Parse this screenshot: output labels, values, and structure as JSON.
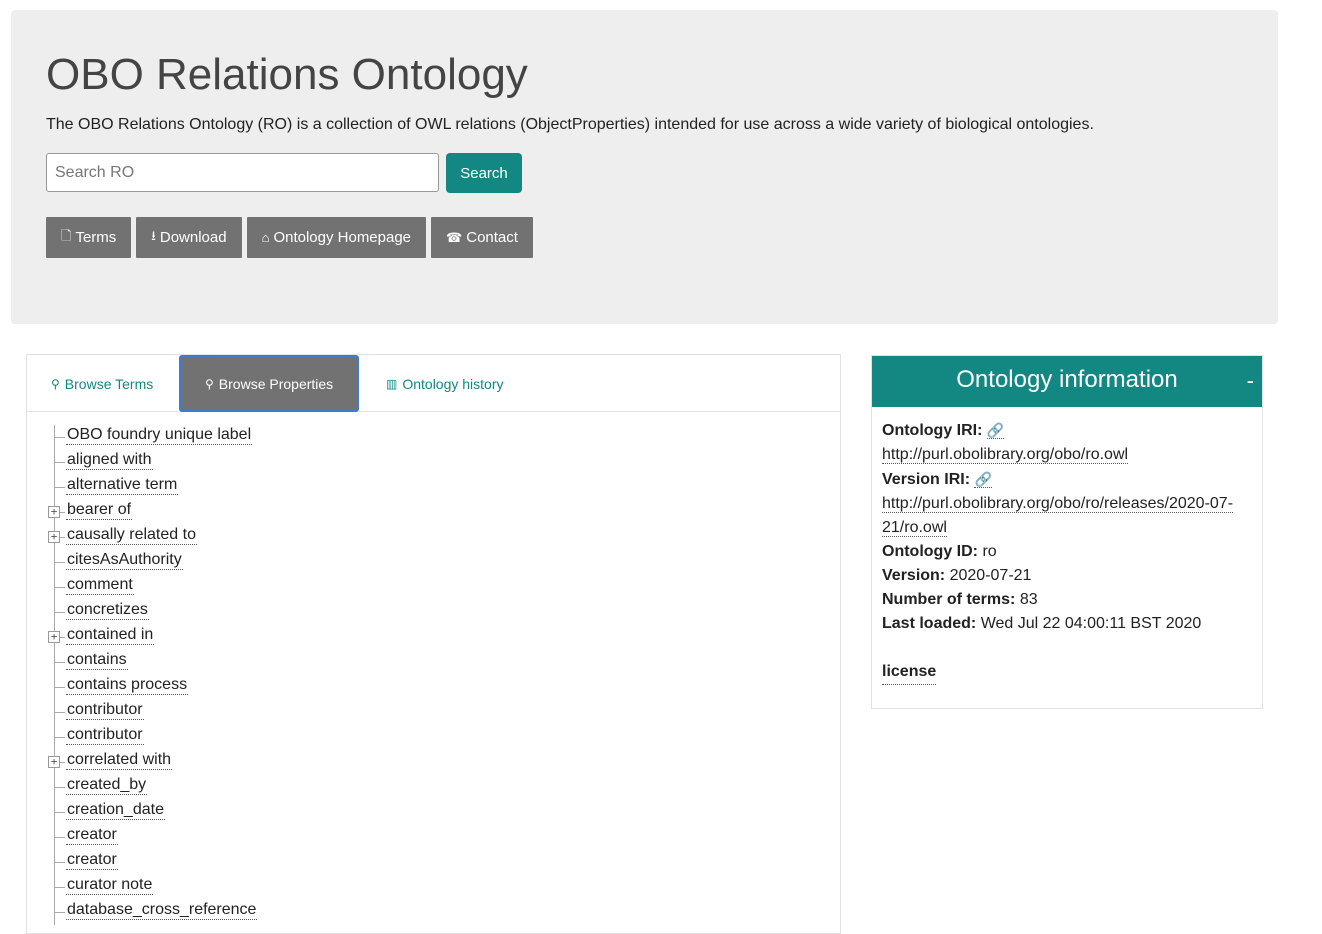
{
  "header": {
    "title": "OBO Relations Ontology",
    "description": "The OBO Relations Ontology (RO) is a collection of OWL relations (ObjectProperties) intended for use across a wide variety of biological ontologies.",
    "search_placeholder": "Search RO",
    "search_button": "Search",
    "nav_buttons": [
      "Terms",
      "Download",
      "Ontology Homepage",
      "Contact"
    ]
  },
  "tabs": [
    "Browse Terms",
    "Browse Properties",
    "Ontology history"
  ],
  "tree": [
    {
      "label": "OBO foundry unique label",
      "expandable": false
    },
    {
      "label": "aligned with",
      "expandable": false
    },
    {
      "label": "alternative term",
      "expandable": false
    },
    {
      "label": "bearer of",
      "expandable": true
    },
    {
      "label": "causally related to",
      "expandable": true
    },
    {
      "label": "citesAsAuthority",
      "expandable": false
    },
    {
      "label": "comment",
      "expandable": false
    },
    {
      "label": "concretizes",
      "expandable": false
    },
    {
      "label": "contained in",
      "expandable": true
    },
    {
      "label": "contains",
      "expandable": false
    },
    {
      "label": "contains process",
      "expandable": false
    },
    {
      "label": "contributor",
      "expandable": false
    },
    {
      "label": "contributor",
      "expandable": false
    },
    {
      "label": "correlated with",
      "expandable": true
    },
    {
      "label": "created_by",
      "expandable": false
    },
    {
      "label": "creation_date",
      "expandable": false
    },
    {
      "label": "creator",
      "expandable": false
    },
    {
      "label": "creator",
      "expandable": false
    },
    {
      "label": "curator note",
      "expandable": false
    },
    {
      "label": "database_cross_reference",
      "expandable": false
    }
  ],
  "info": {
    "title": "Ontology information",
    "collapse_symbol": "-",
    "iri_label": "Ontology IRI:",
    "iri_value": "http://purl.obolibrary.org/obo/ro.owl",
    "version_iri_label": "Version IRI:",
    "version_iri_value_line1": "http://purl.obolibrary.org/obo/ro/releases/2020-07-",
    "version_iri_value_line2": "21/ro.owl",
    "id_label": "Ontology ID:",
    "id_value": "ro",
    "version_label": "Version:",
    "version_value": "2020-07-21",
    "terms_label": "Number of terms:",
    "terms_value": "83",
    "loaded_label": "Last loaded:",
    "loaded_value": "Wed Jul 22 04:00:11 BST 2020",
    "license_label": "license"
  },
  "colors": {
    "accent": "#138882",
    "button_gray": "#727272",
    "jumbotron_bg": "#eeeeee",
    "active_tab_border": "#3c7bd0"
  }
}
